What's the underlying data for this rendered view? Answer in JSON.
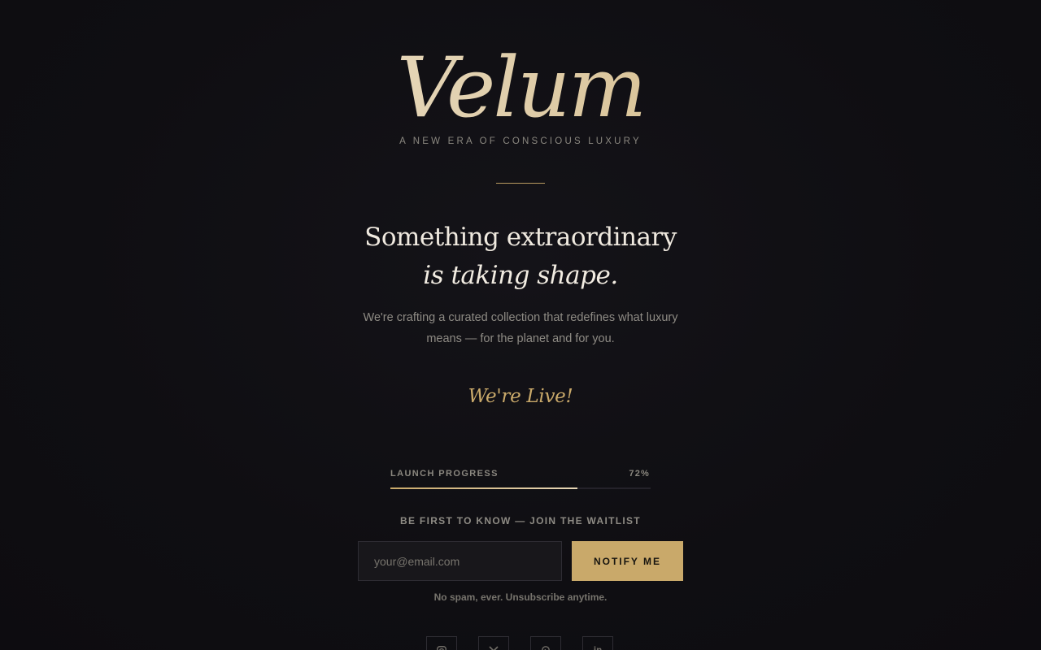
{
  "brand": {
    "logo": "Velum",
    "tagline": "A NEW ERA OF CONSCIOUS LUXURY"
  },
  "hero": {
    "headline_line1": "Something extraordinary",
    "headline_line2": "is taking shape.",
    "description": "We're crafting a curated collection that redefines what luxury means — for the planet and for you.",
    "status": "We're Live!"
  },
  "progress": {
    "label": "LAUNCH PROGRESS",
    "percent_text": "72%",
    "fill_fraction": 0.72
  },
  "waitlist": {
    "label": "BE FIRST TO KNOW — JOIN THE WAITLIST",
    "email_placeholder": "your@email.com",
    "button_label": "NOTIFY ME",
    "note": "No spam, ever. Unsubscribe anytime."
  },
  "social": [
    {
      "icon": "instagram-icon"
    },
    {
      "icon": "x-icon"
    },
    {
      "icon": "pinterest-icon"
    },
    {
      "icon": "linkedin-icon",
      "glyph": "in"
    }
  ],
  "colors": {
    "background": "#0f0e12",
    "accent": "#c9a96a",
    "text": "#efe9df",
    "muted": "#8e8b84"
  }
}
